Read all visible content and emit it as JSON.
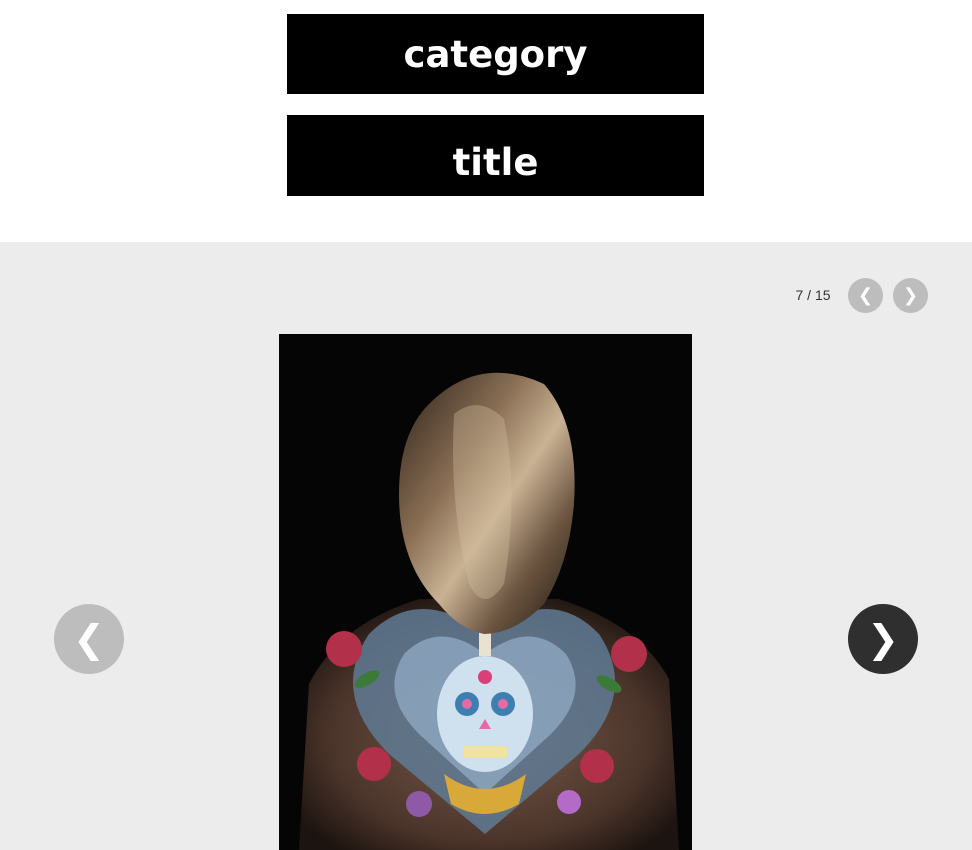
{
  "header": {
    "category": "category",
    "title": "title"
  },
  "gallery": {
    "counter": "7 / 15",
    "prev_icon": "chevron-left-icon",
    "next_icon": "chevron-right-icon",
    "prev_glyph": "❮",
    "next_glyph": "❯",
    "photo_subject": "back-tattoo-photo"
  },
  "colors": {
    "header_bg": "#000000",
    "gallery_bg": "#ececec",
    "nav_inactive": "#bdbdbd",
    "nav_active": "#2f2f2f"
  }
}
